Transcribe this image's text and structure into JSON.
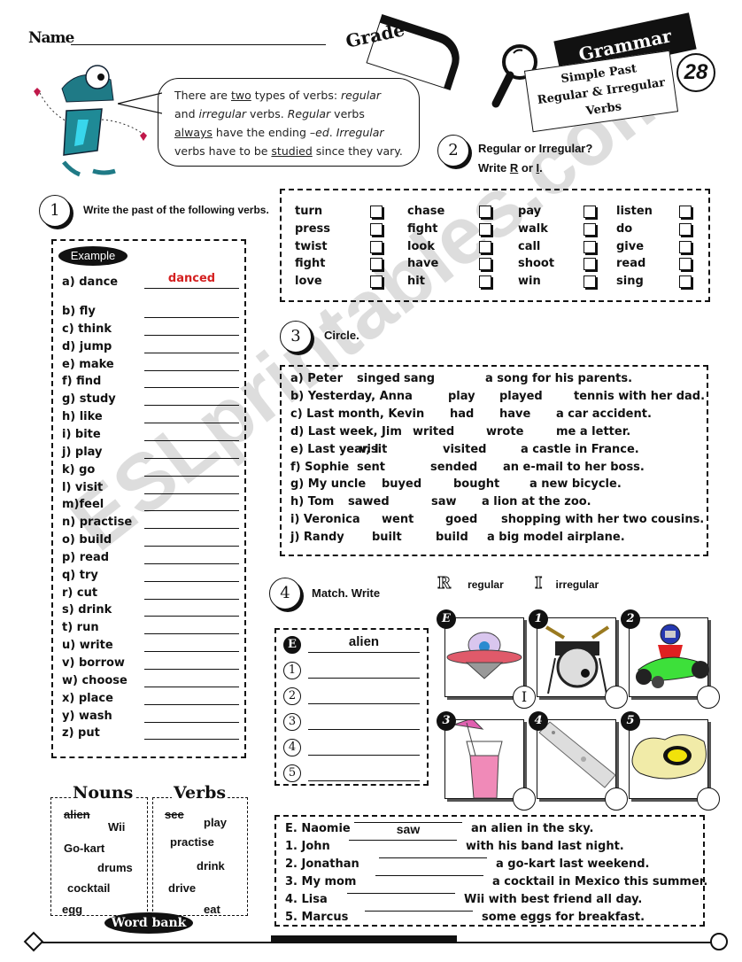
{
  "header": {
    "name_label": "Name",
    "grade_label": "Grade",
    "title": "Grammar Focus",
    "subtitle_lines": [
      "Simple Past",
      "Regular & Irregular",
      "Verbs"
    ],
    "worksheet_number": "28"
  },
  "intro": {
    "text_html": "There are <u>two</u> types of verbs: <i>regular</i> and <i>irregular</i> verbs. <i>Regular</i> verbs <u>always</u> have the ending <i>–ed</i>. <i>Irregular</i> verbs have to be <u>studied</u> since they vary."
  },
  "exercise1": {
    "number": "1",
    "instruction": "Write the past of the following verbs.",
    "example_label": "Example",
    "example": {
      "verb": "a) dance",
      "answer": "danced",
      "answer_color": "#d42020"
    },
    "items": [
      "b) fly",
      "c) think",
      "d) jump",
      "e) make",
      "f) find",
      "g) study",
      "h) like",
      "i) bite",
      "j) play",
      "k) go",
      "l) visit",
      "m)feel",
      "n) practise",
      "o) build",
      "p) read",
      "q) try",
      "r) cut",
      "s) drink",
      "t) run",
      "u) write",
      "v) borrow",
      "w) choose",
      "x) place",
      "y) wash",
      "z) put"
    ]
  },
  "exercise2": {
    "number": "2",
    "instruction_line1": "Regular or Irregular?",
    "instruction_line2": "Write R or I.",
    "columns": [
      [
        "turn",
        "press",
        "twist",
        "fight",
        "love"
      ],
      [
        "chase",
        "fight",
        "look",
        "have",
        "hit"
      ],
      [
        "pay",
        "walk",
        "call",
        "shoot",
        "win"
      ],
      [
        "listen",
        "do",
        "give",
        "read",
        "sing"
      ]
    ]
  },
  "exercise3": {
    "number": "3",
    "instruction": "Circle.",
    "rows": [
      {
        "subject": "a) Peter",
        "opt1": "singed",
        "opt2": "sang",
        "rest": "a song for his parents."
      },
      {
        "subject": "b) Yesterday, Anna",
        "opt1": "play",
        "opt2": "played",
        "rest": "tennis with her dad."
      },
      {
        "subject": "c)  Last month, Kevin",
        "opt1": "had",
        "opt2": "have",
        "rest": "a car accident."
      },
      {
        "subject": "d) Last week, Jim",
        "opt1": "writed",
        "opt2": "wrote",
        "rest": "me a letter."
      },
      {
        "subject": "e) Last year, I",
        "opt1": "visit",
        "opt2": "visited",
        "rest": "a castle in France."
      },
      {
        "subject": "f)  Sophie",
        "opt1": "sent",
        "opt2": "sended",
        "rest": "an e-mail to her boss."
      },
      {
        "subject": "g) My uncle",
        "opt1": "buyed",
        "opt2": "bought",
        "rest": "a new bicycle."
      },
      {
        "subject": "h) Tom",
        "opt1": "sawed",
        "opt2": "saw",
        "rest": "a lion at the zoo."
      },
      {
        "subject": "i) Veronica",
        "opt1": "went",
        "opt2": "goed",
        "rest": "shopping with her two cousins."
      },
      {
        "subject": "j) Randy",
        "opt1": "built",
        "opt2": "build",
        "rest": "a big model airplane."
      }
    ]
  },
  "exercise4": {
    "number": "4",
    "instruction": "Match. Write",
    "legend": [
      {
        "letter": "R",
        "label": "regular"
      },
      {
        "letter": "I",
        "label": "irregular"
      }
    ],
    "rows": [
      {
        "num": "E",
        "answer": "alien"
      },
      {
        "num": "1",
        "answer": ""
      },
      {
        "num": "2",
        "answer": ""
      },
      {
        "num": "3",
        "answer": ""
      },
      {
        "num": "4",
        "answer": ""
      },
      {
        "num": "5",
        "answer": ""
      }
    ],
    "pictures": [
      {
        "tag": "E",
        "subject": "alien-ufo",
        "mark": "I"
      },
      {
        "tag": "1",
        "subject": "drums",
        "mark": ""
      },
      {
        "tag": "2",
        "subject": "go-kart",
        "mark": ""
      },
      {
        "tag": "3",
        "subject": "cocktail",
        "mark": ""
      },
      {
        "tag": "4",
        "subject": "wii-remote",
        "mark": ""
      },
      {
        "tag": "5",
        "subject": "fried-egg",
        "mark": ""
      }
    ]
  },
  "word_bank": {
    "label": "Word bank",
    "nouns_title": "Nouns",
    "verbs_title": "Verbs",
    "nouns": [
      {
        "word": "alien",
        "struck": true
      },
      {
        "word": "Wii",
        "struck": false
      },
      {
        "word": "Go-kart",
        "struck": false
      },
      {
        "word": "drums",
        "struck": false
      },
      {
        "word": "cocktail",
        "struck": false
      },
      {
        "word": "egg",
        "struck": false
      }
    ],
    "verbs": [
      {
        "word": "see",
        "struck": true
      },
      {
        "word": "play",
        "struck": false
      },
      {
        "word": "practise",
        "struck": false
      },
      {
        "word": "drink",
        "struck": false
      },
      {
        "word": "drive",
        "struck": false
      },
      {
        "word": "eat",
        "struck": false
      }
    ]
  },
  "exercise5": {
    "rows": [
      {
        "subject": "E. Naomie",
        "answer": "saw",
        "rest": "an alien in the sky."
      },
      {
        "subject": "1. John",
        "answer": "",
        "rest": "with his band last night."
      },
      {
        "subject": "2. Jonathan",
        "answer": "",
        "rest": "a go-kart last weekend."
      },
      {
        "subject": "3. My mom",
        "answer": "",
        "rest": "a cocktail in Mexico this summer."
      },
      {
        "subject": "4. Lisa",
        "answer": "",
        "rest": "Wii with best friend all day."
      },
      {
        "subject": "5. Marcus",
        "answer": "",
        "rest": "some eggs for breakfast."
      }
    ]
  },
  "watermark": "ESLprintables.com"
}
